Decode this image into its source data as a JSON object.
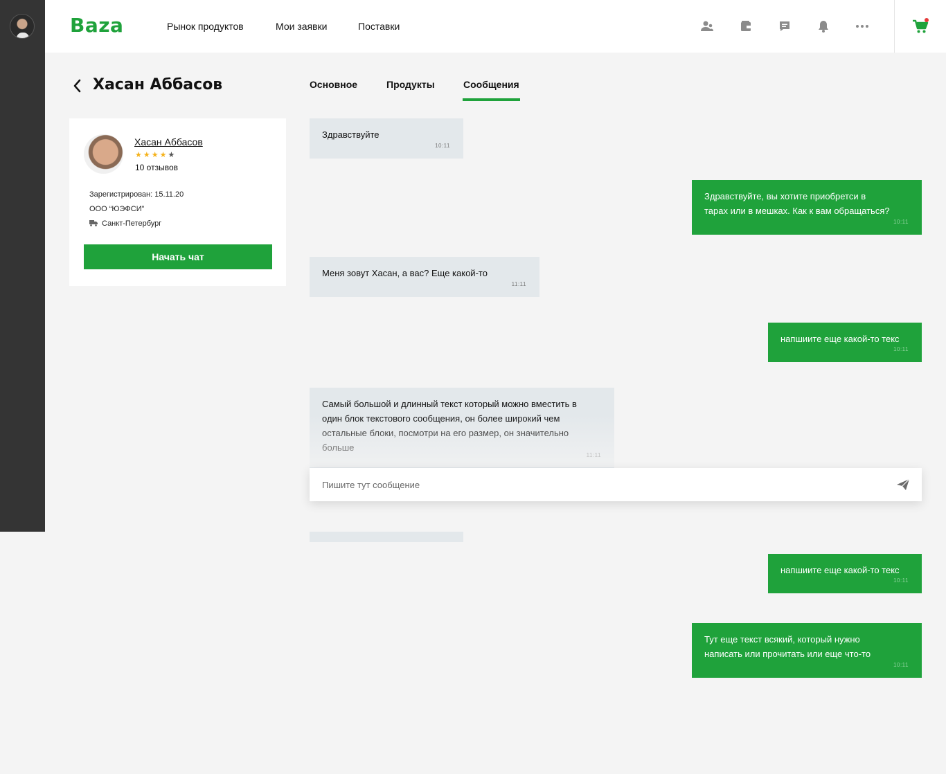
{
  "topbar": {
    "logo": "Baza",
    "nav": [
      "Рынок продуктов",
      "Мои заявки",
      "Поставки"
    ],
    "icons": [
      "users-icon",
      "wallet-icon",
      "chat-icon",
      "bell-icon",
      "more-icon",
      "cart-icon"
    ],
    "accent_color": "#1fa23b",
    "notification_color": "#e53a3a"
  },
  "page": {
    "title": "Хасан Аббасов"
  },
  "profile": {
    "name": "Хасан Аббасов",
    "rating": 4,
    "rating_max": 5,
    "reviews": "10 отзывов",
    "registered": "Зарегистрирован: 15.11.20",
    "company": "ООО “ЮЭФСИ”",
    "city": "Санкт-Петербург",
    "start_chat": "Начать чат"
  },
  "tabs": [
    {
      "label": "Основное",
      "active": false
    },
    {
      "label": "Продукты",
      "active": false
    },
    {
      "label": "Сообщения",
      "active": true
    }
  ],
  "messages": [
    {
      "direction": "in",
      "lines": [
        "Здравствуйте"
      ],
      "time": "10:11"
    },
    {
      "direction": "out",
      "lines": [
        "Здравствуйте, вы хотите приобретси в",
        "тарах или в мешках. Как к вам обращаться?"
      ],
      "time": "10:11"
    },
    {
      "direction": "in",
      "lines": [
        "Меня зовут Хасан, а вас? Еще какой-то"
      ],
      "time": "11:11"
    },
    {
      "direction": "out",
      "lines": [
        "напшиите еще какой-то текс"
      ],
      "time": "10:11"
    },
    {
      "direction": "in",
      "lines": [
        "Самый большой и длинный текст который можно вместить в",
        "один блок текстового сообщения, он более широкий чем",
        "остальные блоки, посмотри на его размер, он значительно",
        "больше"
      ],
      "time": "11:11"
    },
    {
      "direction": "out",
      "lines": [
        "напшиите еще какой-то текс"
      ],
      "time": "10:11"
    },
    {
      "direction": "out",
      "lines": [
        "Тут еще текст всякий, который нужно",
        "написать или прочитать или еще что-то"
      ],
      "time": "10:11"
    }
  ],
  "composer": {
    "placeholder": "Пишите тут сообщение"
  }
}
